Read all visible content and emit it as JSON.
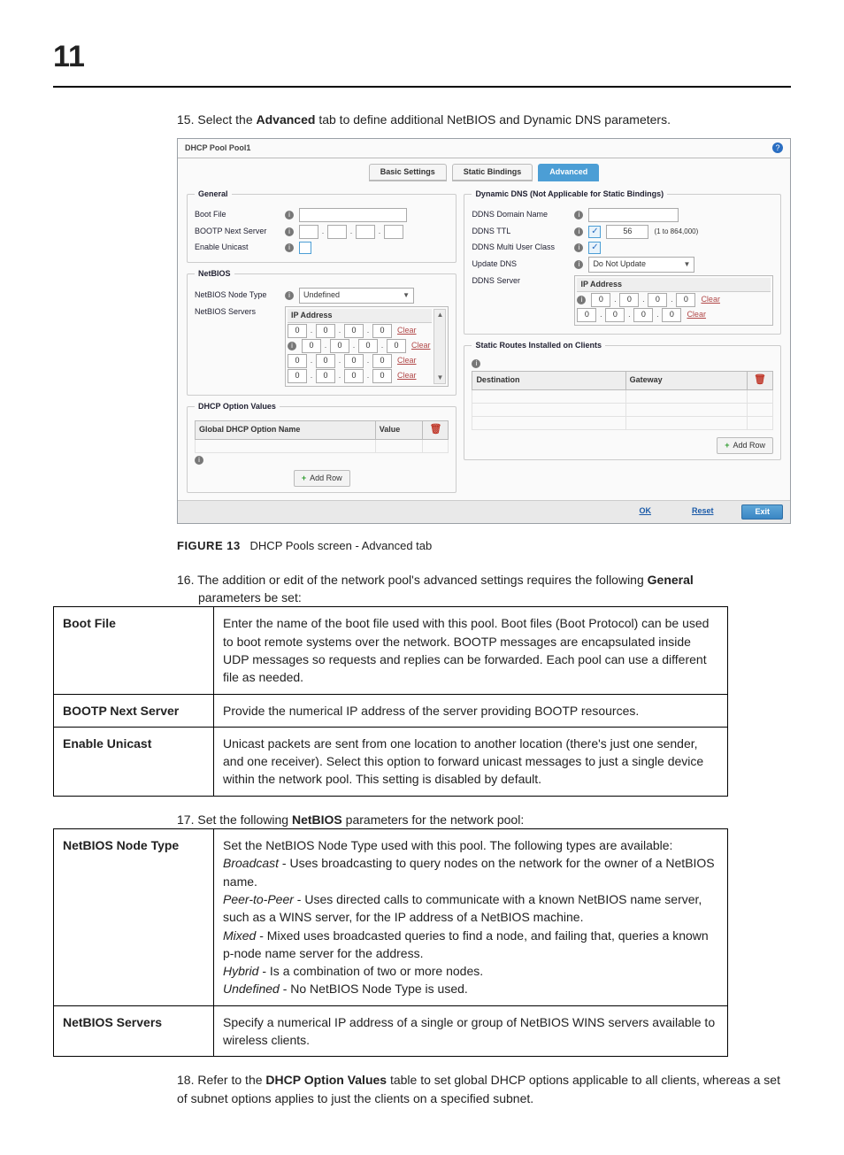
{
  "page_number": "11",
  "step15_prefix": "15. ",
  "step15_a": "Select the ",
  "step15_b": "Advanced",
  "step15_c": " tab to define additional NetBIOS and Dynamic DNS parameters.",
  "screenshot": {
    "title_bold": "DHCP Pool",
    "title_muted": "Pool1",
    "tabs": {
      "basic": "Basic Settings",
      "static": "Static Bindings",
      "advanced": "Advanced"
    },
    "general": {
      "legend": "General",
      "boot_file": "Boot File",
      "bootp_next": "BOOTP Next Server",
      "enable_unicast": "Enable Unicast"
    },
    "netbios": {
      "legend": "NetBIOS",
      "node_type": "NetBIOS Node Type",
      "node_type_val": "Undefined",
      "servers": "NetBIOS Servers",
      "ip_header": "IP Address",
      "ip_default": "0",
      "clear": "Clear"
    },
    "dhcp_options": {
      "legend": "DHCP Option Values",
      "col_name": "Global DHCP Option Name",
      "col_value": "Value",
      "add_row": "Add Row"
    },
    "ddns": {
      "legend": "Dynamic DNS (Not Applicable for Static Bindings)",
      "domain_name": "DDNS Domain Name",
      "ttl": "DDNS TTL",
      "ttl_val": "56",
      "ttl_range": "(1 to 864,000)",
      "multi_user": "DDNS Multi User Class",
      "update_dns": "Update DNS",
      "update_dns_val": "Do Not Update",
      "ddns_server": "DDNS Server",
      "ip_header": "IP Address",
      "ip_default": "0",
      "clear": "Clear"
    },
    "static_routes": {
      "legend": "Static Routes Installed on Clients",
      "col_dest": "Destination",
      "col_gw": "Gateway",
      "add_row": "Add Row"
    },
    "footer": {
      "ok": "OK",
      "reset": "Reset",
      "exit": "Exit"
    }
  },
  "figure": {
    "lead": "FIGURE 13",
    "caption": "DHCP Pools screen - Advanced tab"
  },
  "step16_prefix": "16. ",
  "step16_a": "The addition or edit of the network pool's advanced settings requires the following ",
  "step16_b": "General",
  "step16_c": " parameters be set:",
  "table_general": {
    "boot_file_h": "Boot File",
    "boot_file_d": "Enter the name of the boot file used with this pool. Boot files (Boot Protocol) can be used to boot remote systems over the network. BOOTP messages are encapsulated inside UDP messages so requests and replies can be forwarded. Each pool can use a different file as needed.",
    "bootp_h": "BOOTP Next Server",
    "bootp_d": "Provide the numerical IP address of the server providing BOOTP resources.",
    "unicast_h": "Enable Unicast",
    "unicast_d": "Unicast packets are sent from one location to another location (there's just one sender, and one receiver). Select this option to forward unicast messages to just a single device within the network pool. This setting is disabled by default."
  },
  "step17_prefix": "17. ",
  "step17_a": "Set the following ",
  "step17_b": "NetBIOS",
  "step17_c": " parameters for the network pool:",
  "table_netbios": {
    "node_h": "NetBIOS Node Type",
    "node_d1": "Set the NetBIOS Node Type used with this pool. The following types are available:",
    "node_b_i": "Broadcast",
    "node_b_t": " - Uses broadcasting to query nodes on the network for the owner of a NetBIOS name.",
    "node_p_i": "Peer-to-Peer",
    "node_p_t": " - Uses directed calls to communicate with a known NetBIOS name server, such as a WINS server, for the IP address of a NetBIOS machine.",
    "node_m_i": "Mixed",
    "node_m_t": " - Mixed uses broadcasted queries to find a node, and failing that, queries a known p-node name server for the address.",
    "node_h_i": "Hybrid",
    "node_h_t": " - Is a combination of two or more nodes.",
    "node_u_i": "Undefined",
    "node_u_t": " - No NetBIOS Node Type is used.",
    "servers_h": "NetBIOS Servers",
    "servers_d": "Specify a numerical IP address of a single or group of NetBIOS WINS servers available to wireless clients."
  },
  "step18_prefix": "18. ",
  "step18_a": "Refer to the ",
  "step18_b": "DHCP Option Values",
  "step18_c": " table to set global DHCP options applicable to all clients, whereas a set of subnet options applies to just the clients on a specified subnet."
}
